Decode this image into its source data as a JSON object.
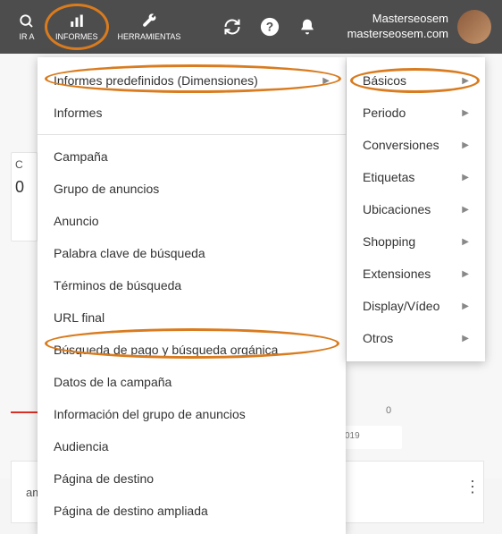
{
  "topbar": {
    "goto": "IR A",
    "reports": "INFORMES",
    "tools": "HERRAMIENTAS",
    "user_name": "Masterseosem",
    "user_domain": "masterseosem.com"
  },
  "bg": {
    "card1_letter": "C",
    "card1_value": "0",
    "chart_zero": "0",
    "chart_date": "019",
    "bottom_label": "ampañ"
  },
  "menu_main": {
    "predefined": "Informes predefinidos (Dimensiones)",
    "informes": "Informes",
    "items": [
      "Campaña",
      "Grupo de anuncios",
      "Anuncio",
      "Palabra clave de búsqueda",
      "Términos de búsqueda",
      "URL final",
      "Búsqueda de pago y búsqueda orgánica",
      "Datos de la campaña",
      "Información del grupo de anuncios",
      "Audiencia",
      "Página de destino",
      "Página de destino ampliada"
    ]
  },
  "menu_sub": {
    "items": [
      "Básicos",
      "Periodo",
      "Conversiones",
      "Etiquetas",
      "Ubicaciones",
      "Shopping",
      "Extensiones",
      "Display/Vídeo",
      "Otros"
    ]
  }
}
